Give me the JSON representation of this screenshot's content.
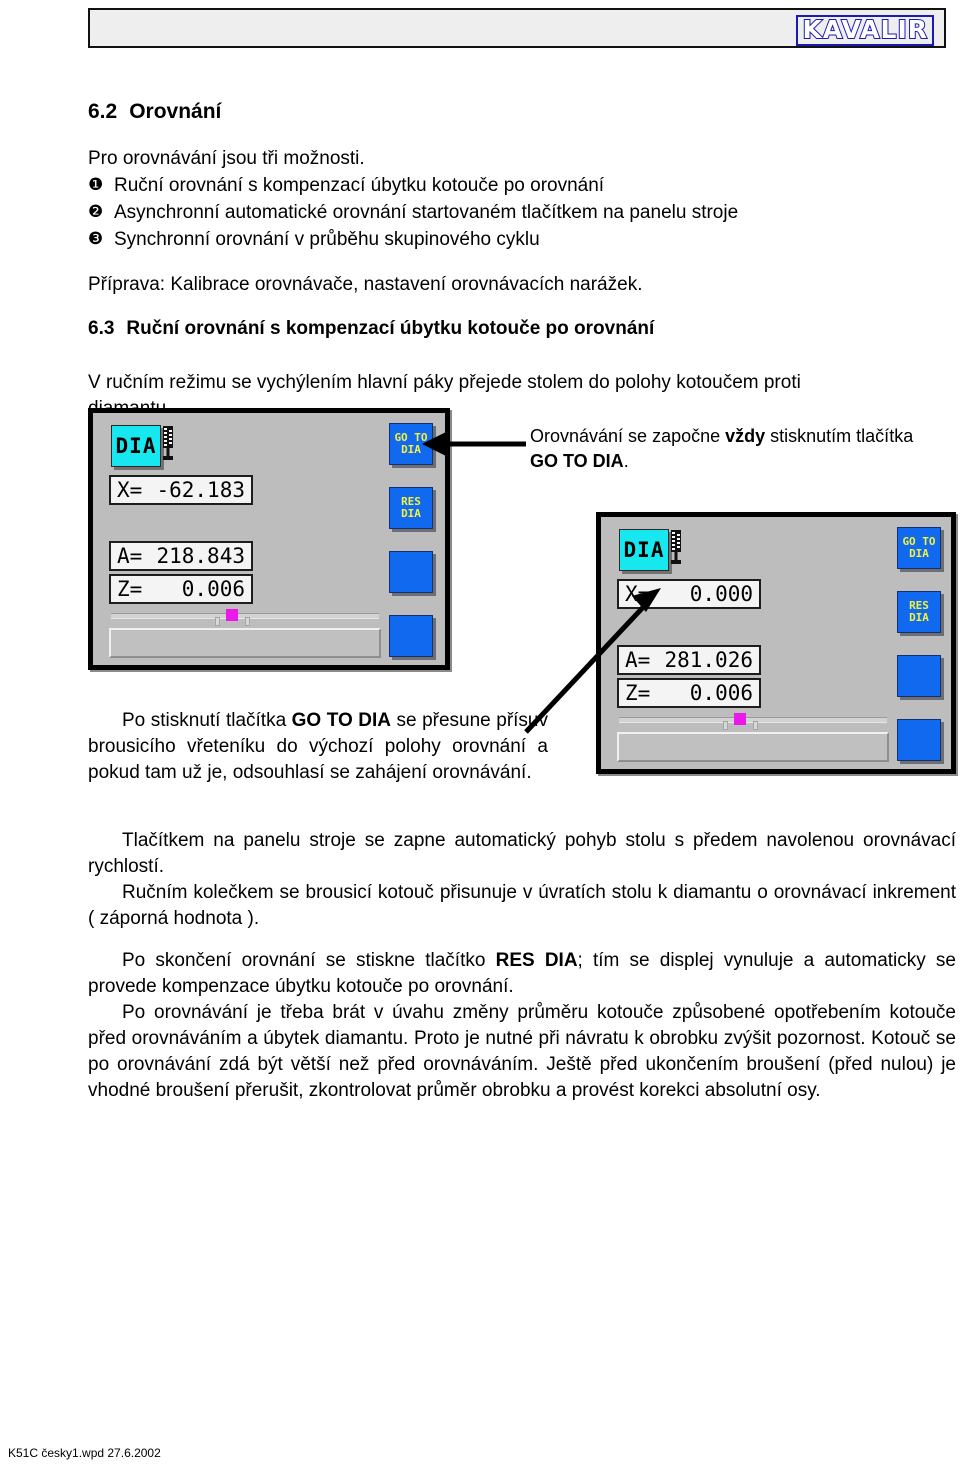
{
  "header": {
    "logo_text": "KAVALIR"
  },
  "section": {
    "h2_number": "6.2",
    "h2_title": "Orovnání",
    "intro": "Pro orovnávání jsou tři možnosti.",
    "options": [
      {
        "marker": "❶",
        "text": "Ruční orovnání s kompenzací úbytku kotouče po orovnání"
      },
      {
        "marker": "❷",
        "text": "Asynchronní automatické orovnání startovaném tlačítkem na panelu stroje"
      },
      {
        "marker": "❸",
        "text": "Synchronní orovnání v průběhu skupinového cyklu"
      }
    ],
    "preparation": "Příprava: Kalibrace orovnávače, nastavení orovnávacích narážek.",
    "h3_number": "6.3",
    "h3_title": "Ruční orovnání s kompenzací úbytku kotouče po orovnání",
    "lead": "V ručním režimu se vychýlením hlavní páky přejede stolem do polohy kotoučem proti diamantu."
  },
  "panel_left": {
    "name": "control-panel-before",
    "badge": "DIA",
    "tool_icon": "grinding-wheel-dresser-icon",
    "fields": [
      {
        "label": "X=",
        "value": "-62.183"
      },
      {
        "label": "A=",
        "value": "218.843"
      },
      {
        "label": "Z=",
        "value": "0.006"
      }
    ],
    "buttons": [
      {
        "line1": "GO TO",
        "line2": "DIA"
      },
      {
        "line1": "RES",
        "line2": "DIA"
      },
      {
        "line1": "",
        "line2": ""
      },
      {
        "line1": "",
        "line2": ""
      }
    ]
  },
  "panel_right": {
    "name": "control-panel-after",
    "badge": "DIA",
    "tool_icon": "grinding-wheel-dresser-icon",
    "fields": [
      {
        "label": "X=",
        "value": "0.000"
      },
      {
        "label": "A=",
        "value": "281.026"
      },
      {
        "label": "Z=",
        "value": "0.006"
      }
    ],
    "buttons": [
      {
        "line1": "GO TO",
        "line2": "DIA"
      },
      {
        "line1": "RES",
        "line2": "DIA"
      },
      {
        "line1": "",
        "line2": ""
      },
      {
        "line1": "",
        "line2": ""
      }
    ]
  },
  "callouts": {
    "goto_note_a": "Orovnávání se započne ",
    "goto_note_b": "vždy",
    "goto_note_c": " stisknutím tlačítka ",
    "goto_note_d": "GO TO DIA",
    "goto_note_e": ".",
    "press_note_a": "Po stisknutí tlačítka ",
    "press_note_b": "GO TO DIA",
    "press_note_c": " se přesune přísuv brousicího vřeteníku do výchozí polohy orovnání a pokud tam už je, odsouhlasí se zahájení orovnávání."
  },
  "paragraphs": {
    "p1": "Tlačítkem na panelu stroje se zapne automatický pohyb stolu s předem navolenou orovnávací rychlostí.",
    "p2": "Ručním kolečkem se brousicí kotouč přisunuje v úvratích stolu k diamantu o orovnávací inkrement ( záporná hodnota ).",
    "p3_a": "Po skončení orovnání se stiskne tlačítko ",
    "p3_b": "RES DIA",
    "p3_c": "; tím se displej vynuluje a automaticky se provede kompenzace úbytku kotouče po orovnání.",
    "p4": "Po orovnávání je třeba brát v úvahu změny průměru kotouče způsobené opotřebením kotouče před orovnáváním a úbytek diamantu. Proto je nutné při návratu k obrobku zvýšit pozornost. Kotouč se po orovnávání zdá být větší než před orovnáváním.  Ještě před ukončením broušení (před nulou) je vhodné broušení přerušit, zkontrolovat průměr obrobku a provést korekci absolutní osy."
  },
  "footer": {
    "text": "K51C česky1.wpd  27.6.2002"
  }
}
